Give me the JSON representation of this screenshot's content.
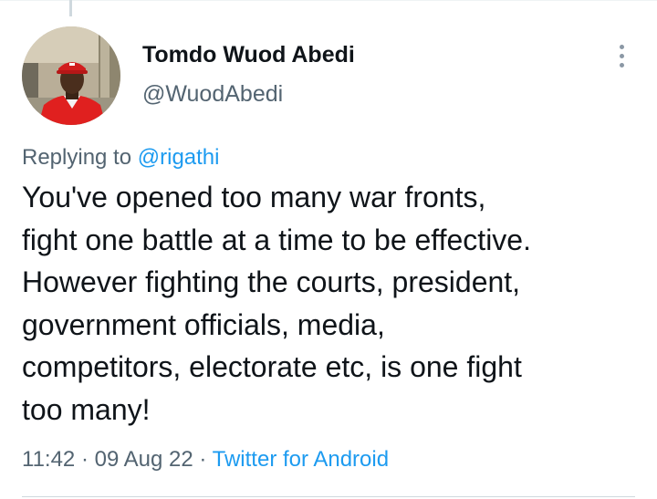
{
  "author": {
    "display_name": "Tomdo Wuod Abedi",
    "handle": "@WuodAbedi"
  },
  "reply": {
    "prefix": "Replying to",
    "mention": "@rigathi"
  },
  "tweet": {
    "lines": [
      "You've opened too many war fronts,",
      "fight one battle at a time to be effective.",
      "However fighting the courts, president,",
      "government officials, media,",
      "competitors, electorate etc, is one fight",
      "too many!"
    ]
  },
  "meta": {
    "time": "11:42",
    "separator": "·",
    "date": "09 Aug 22",
    "source": "Twitter for Android"
  },
  "icons": {
    "more": "more-vertical-icon",
    "avatar": "profile-photo"
  },
  "colors": {
    "link": "#1d9bf0",
    "secondary_text": "#536471",
    "primary_text": "#0f1419",
    "avatar_shirt": "#e0201f"
  }
}
